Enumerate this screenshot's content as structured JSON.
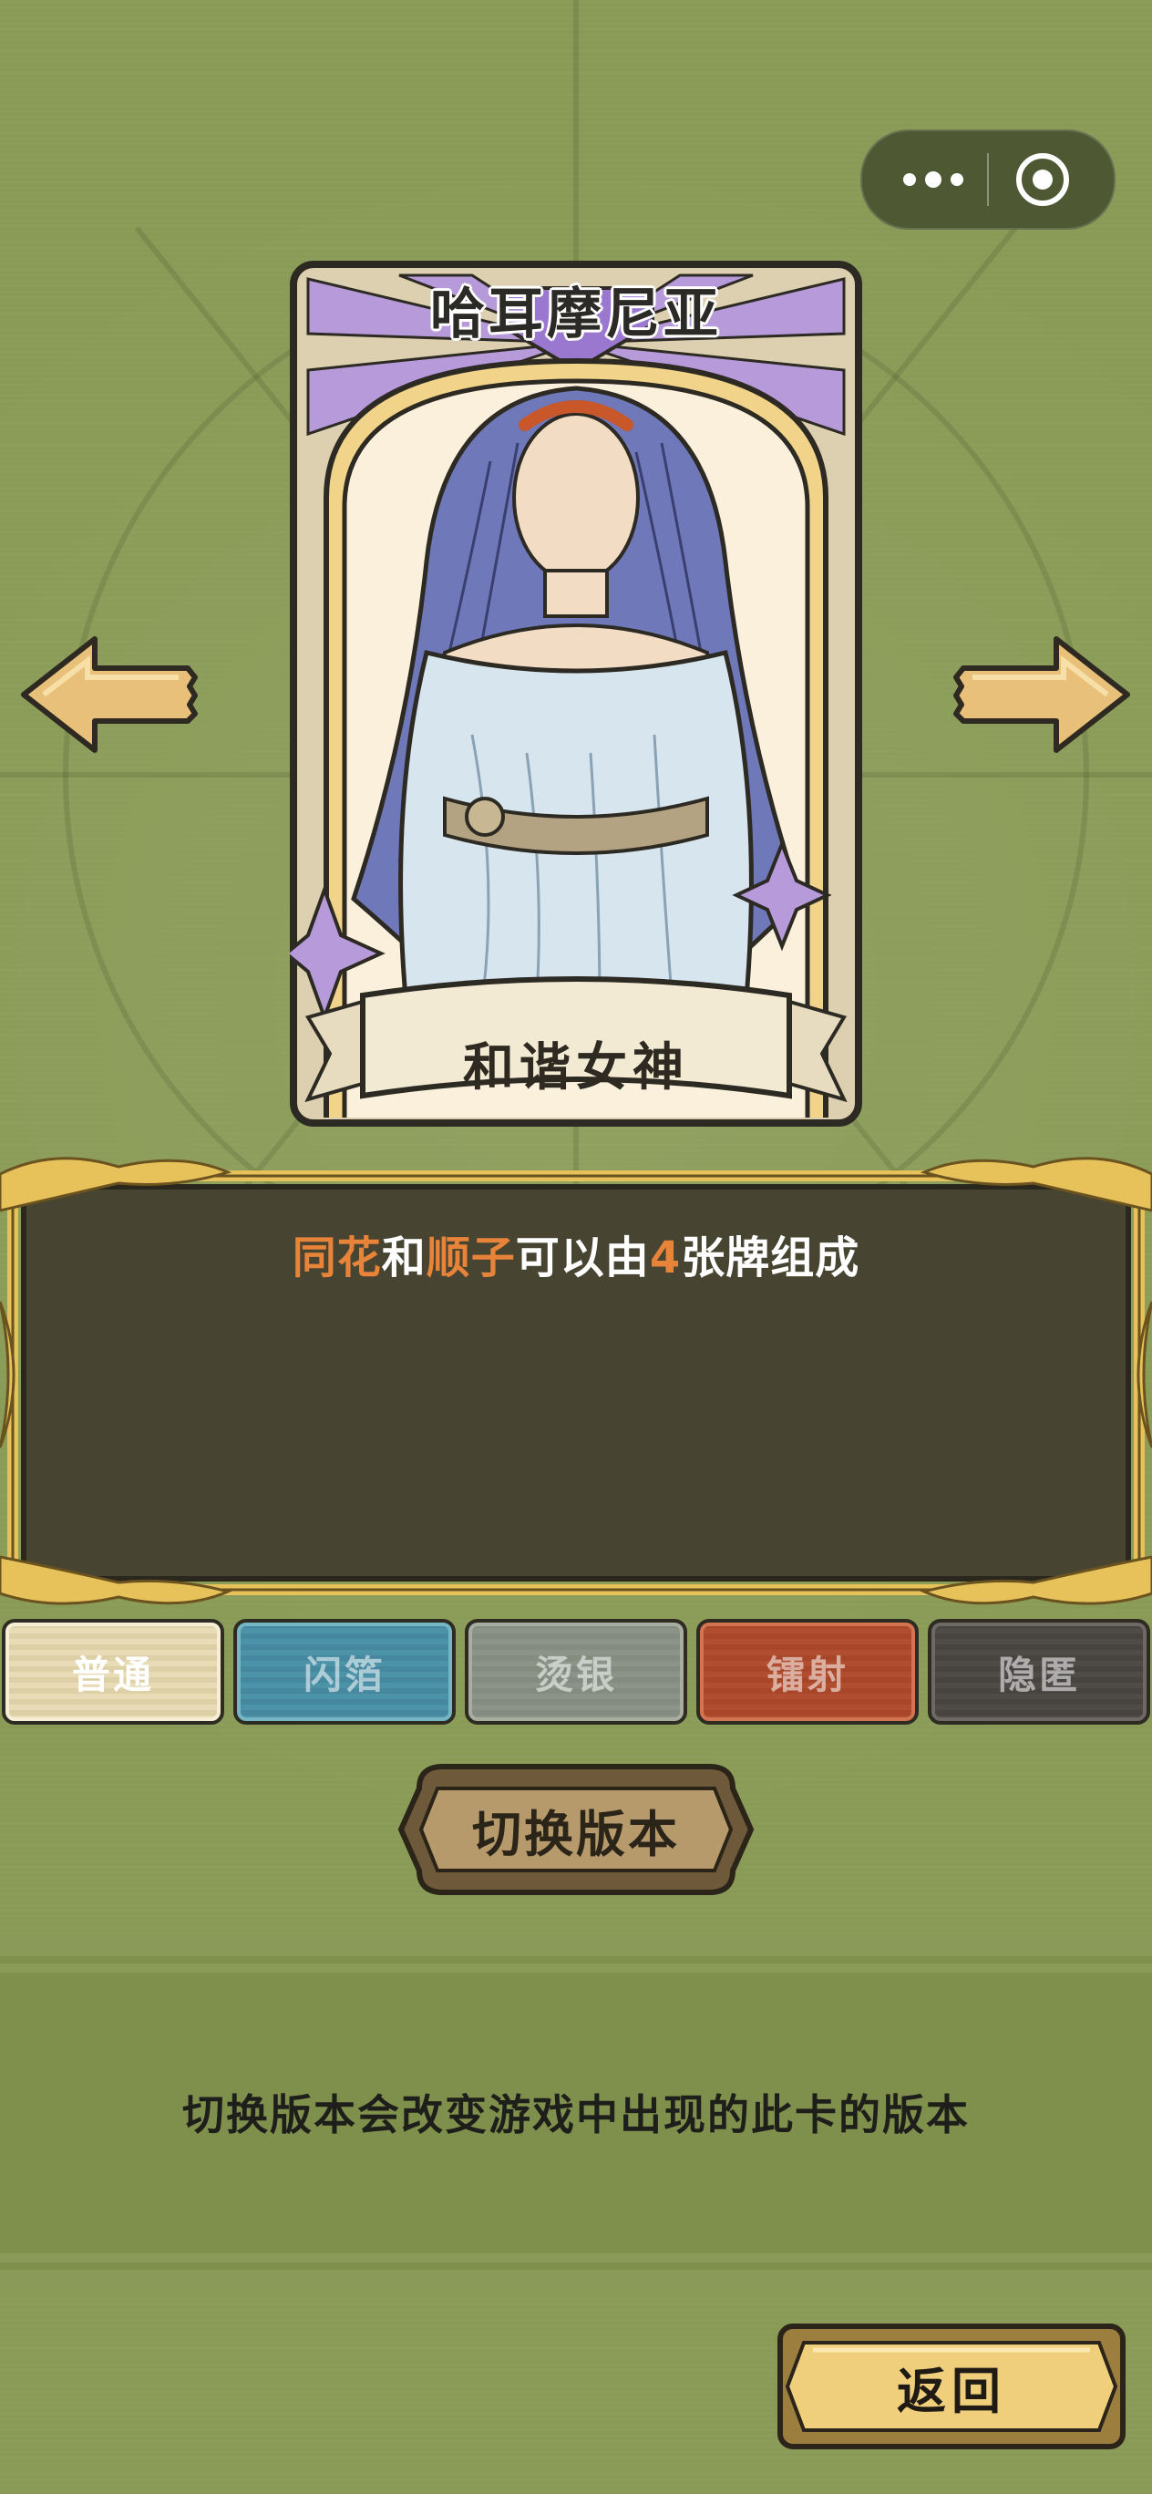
{
  "capsule": {
    "more_icon": "more-dots-icon",
    "close_icon": "target-circle-icon"
  },
  "nav": {
    "prev_icon": "arrow-left-icon",
    "next_icon": "arrow-right-icon"
  },
  "card": {
    "title": "哈耳摩尼亚",
    "name": "和谐女神",
    "frame_color": "#b39ad8"
  },
  "description": {
    "segments": [
      {
        "text": "同花",
        "highlight": true
      },
      {
        "text": "和",
        "highlight": false
      },
      {
        "text": "顺子",
        "highlight": true
      },
      {
        "text": "可以由",
        "highlight": false
      },
      {
        "text": "4",
        "highlight": true
      },
      {
        "text": "张牌组成",
        "highlight": false
      }
    ],
    "highlight_color": "#e8833a"
  },
  "versions": {
    "selected": "普通",
    "tabs": [
      {
        "label": "普通",
        "color": "#e8dcb6"
      },
      {
        "label": "闪箔",
        "color": "#4d93a8"
      },
      {
        "label": "烫银",
        "color": "#8c9489"
      },
      {
        "label": "镭射",
        "color": "#b24e30"
      },
      {
        "label": "隐匿",
        "color": "#4f4b49"
      }
    ]
  },
  "switch_button": {
    "label": "切换版本"
  },
  "info": {
    "text": "切换版本会改变游戏中出现的此卡的版本"
  },
  "back_button": {
    "label": "返回"
  },
  "colors": {
    "background": "#8b9c58",
    "panel": "#474431",
    "gold": "#e7c25a"
  }
}
